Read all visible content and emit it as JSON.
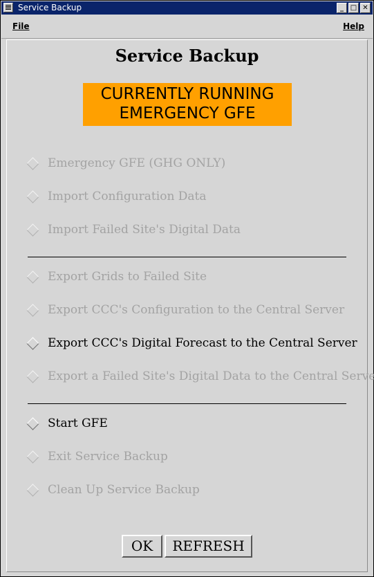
{
  "window": {
    "title": "Service Backup"
  },
  "menubar": {
    "file": "File",
    "help": "Help"
  },
  "heading": "Service Backup",
  "status": {
    "line1": "CURRENTLY RUNNING",
    "line2": "EMERGENCY GFE",
    "color": "#ffa000"
  },
  "options": [
    {
      "label": "Emergency GFE (GHG ONLY)",
      "enabled": false
    },
    {
      "label": "Import Configuration Data",
      "enabled": false
    },
    {
      "label": "Import Failed Site's Digital Data",
      "enabled": false
    },
    {
      "label": "Export Grids to Failed Site",
      "enabled": false
    },
    {
      "label": "Export CCC's Configuration to the Central Server",
      "enabled": false
    },
    {
      "label": "Export CCC's Digital Forecast to the Central Server",
      "enabled": true
    },
    {
      "label": "Export a Failed Site's Digital Data to the Central Server",
      "enabled": false
    },
    {
      "label": "Start GFE",
      "enabled": true
    },
    {
      "label": "Exit Service Backup",
      "enabled": false
    },
    {
      "label": "Clean Up Service Backup",
      "enabled": false
    }
  ],
  "buttons": {
    "ok": "OK",
    "refresh": "REFRESH"
  },
  "titlebar_buttons": {
    "minimize": "_",
    "maximize": "□",
    "close": "✕"
  }
}
